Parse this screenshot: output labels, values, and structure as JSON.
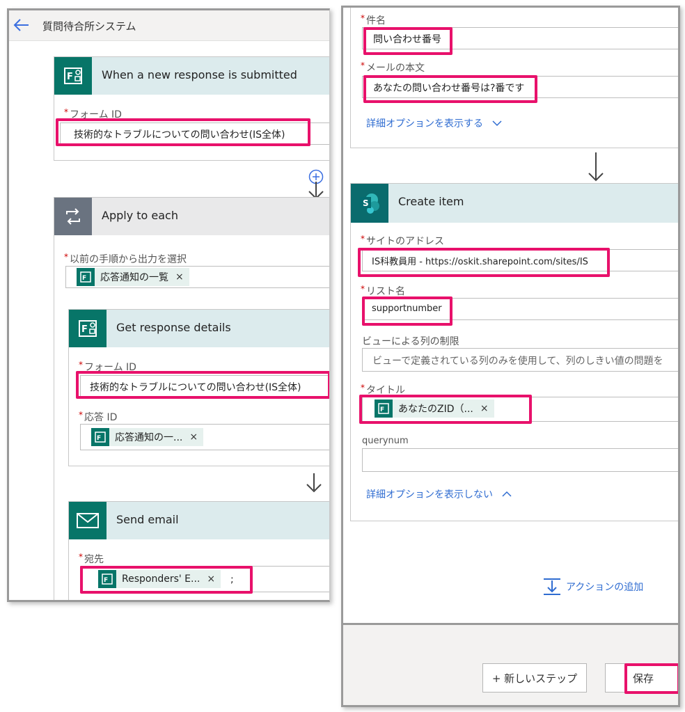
{
  "left": {
    "header_title": "質問待合所システム",
    "trigger": {
      "title": "When a new response is submitted",
      "form_id_label": "フォーム ID",
      "form_id_value": "技術的なトラブルについての問い合わせ(IS全体)"
    },
    "apply": {
      "title": "Apply to each",
      "select_label": "以前の手順から出力を選択",
      "select_token": "応答通知の一覧"
    },
    "details": {
      "title": "Get response details",
      "form_id_label": "フォーム ID",
      "form_id_value": "技術的なトラブルについての問い合わせ(IS全体)",
      "response_id_label": "応答 ID",
      "response_token": "応答通知の一..."
    },
    "email": {
      "title": "Send email",
      "to_label": "宛先",
      "to_token": "Responders' E...",
      "to_suffix": ";"
    }
  },
  "right": {
    "subject_label": "件名",
    "subject_value": "問い合わせ番号",
    "body_label": "メールの本文",
    "body_value": "あなたの問い合わせ番号は?番です",
    "show_advanced": "詳細オプションを表示する",
    "create": {
      "title": "Create item",
      "site_label": "サイトのアドレス",
      "site_value": "IS科教員用 - https://oskit.sharepoint.com/sites/IS",
      "list_label": "リスト名",
      "list_value": "supportnumber",
      "view_label": "ビューによる列の制限",
      "view_placeholder": "ビューで定義されている列のみを使用して、列のしきい値の問題を",
      "title_label": "タイトル",
      "title_token": "あなたのZID（...",
      "querynum_label": "querynum",
      "hide_advanced": "詳細オプションを表示しない"
    },
    "add_action": "アクションの追加",
    "new_step": "+ 新しいステップ",
    "save": "保存",
    "required_mark": "*"
  },
  "colors": {
    "highlight": "#e8116b",
    "forms_green": "#077568",
    "link_blue": "#2f6cd1",
    "header_tint": "#dcebed"
  }
}
